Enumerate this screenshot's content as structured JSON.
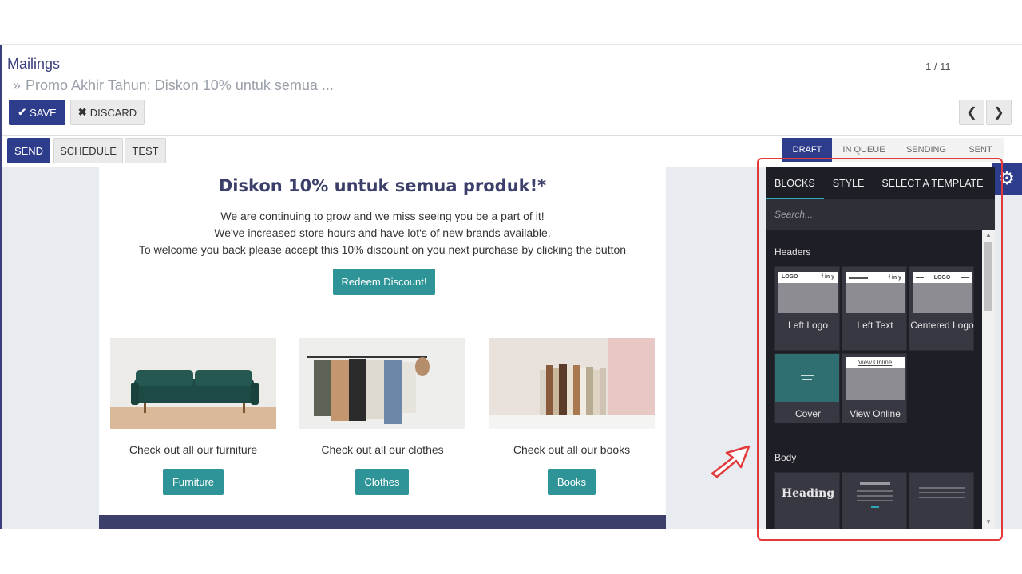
{
  "breadcrumb": {
    "root": "Mailings",
    "separator": "»",
    "current": "Promo Akhir Tahun: Diskon 10% untuk semua ..."
  },
  "toolbar": {
    "save_label": "SAVE",
    "discard_label": "DISCARD",
    "pager": "1 / 11"
  },
  "actions": {
    "send": "SEND",
    "schedule": "SCHEDULE",
    "test": "TEST"
  },
  "stages": [
    "DRAFT",
    "IN QUEUE",
    "SENDING",
    "SENT"
  ],
  "email": {
    "title": "Diskon 10% untuk semua produk!*",
    "lines": [
      "We are continuing to grow and we miss seeing you be a part of it!",
      "We've increased store hours and have lot's of new brands available.",
      "To welcome you back please accept this 10% discount on you next purchase by clicking the button"
    ],
    "cta": "Redeem Discount!",
    "products": [
      {
        "caption": "Check out all our furniture",
        "button": "Furniture"
      },
      {
        "caption": "Check out all our clothes",
        "button": "Clothes"
      },
      {
        "caption": "Check out all our books",
        "button": "Books"
      }
    ]
  },
  "panel": {
    "tabs": [
      "BLOCKS",
      "STYLE",
      "SELECT A TEMPLATE"
    ],
    "search_placeholder": "Search...",
    "headers_label": "Headers",
    "headers": [
      "Left Logo",
      "Left Text",
      "Centered Logo",
      "Cover",
      "View Online"
    ],
    "thumb_logo": "LOGO",
    "thumb_social": "f in y",
    "thumb_view_online": "View Online",
    "body_label": "Body",
    "body_heading_preview": "Heading"
  },
  "colors": {
    "primary": "#2e3c8c",
    "teal": "#2e9497",
    "panel_bg": "#1e1e26",
    "highlight": "#e23a3a"
  }
}
